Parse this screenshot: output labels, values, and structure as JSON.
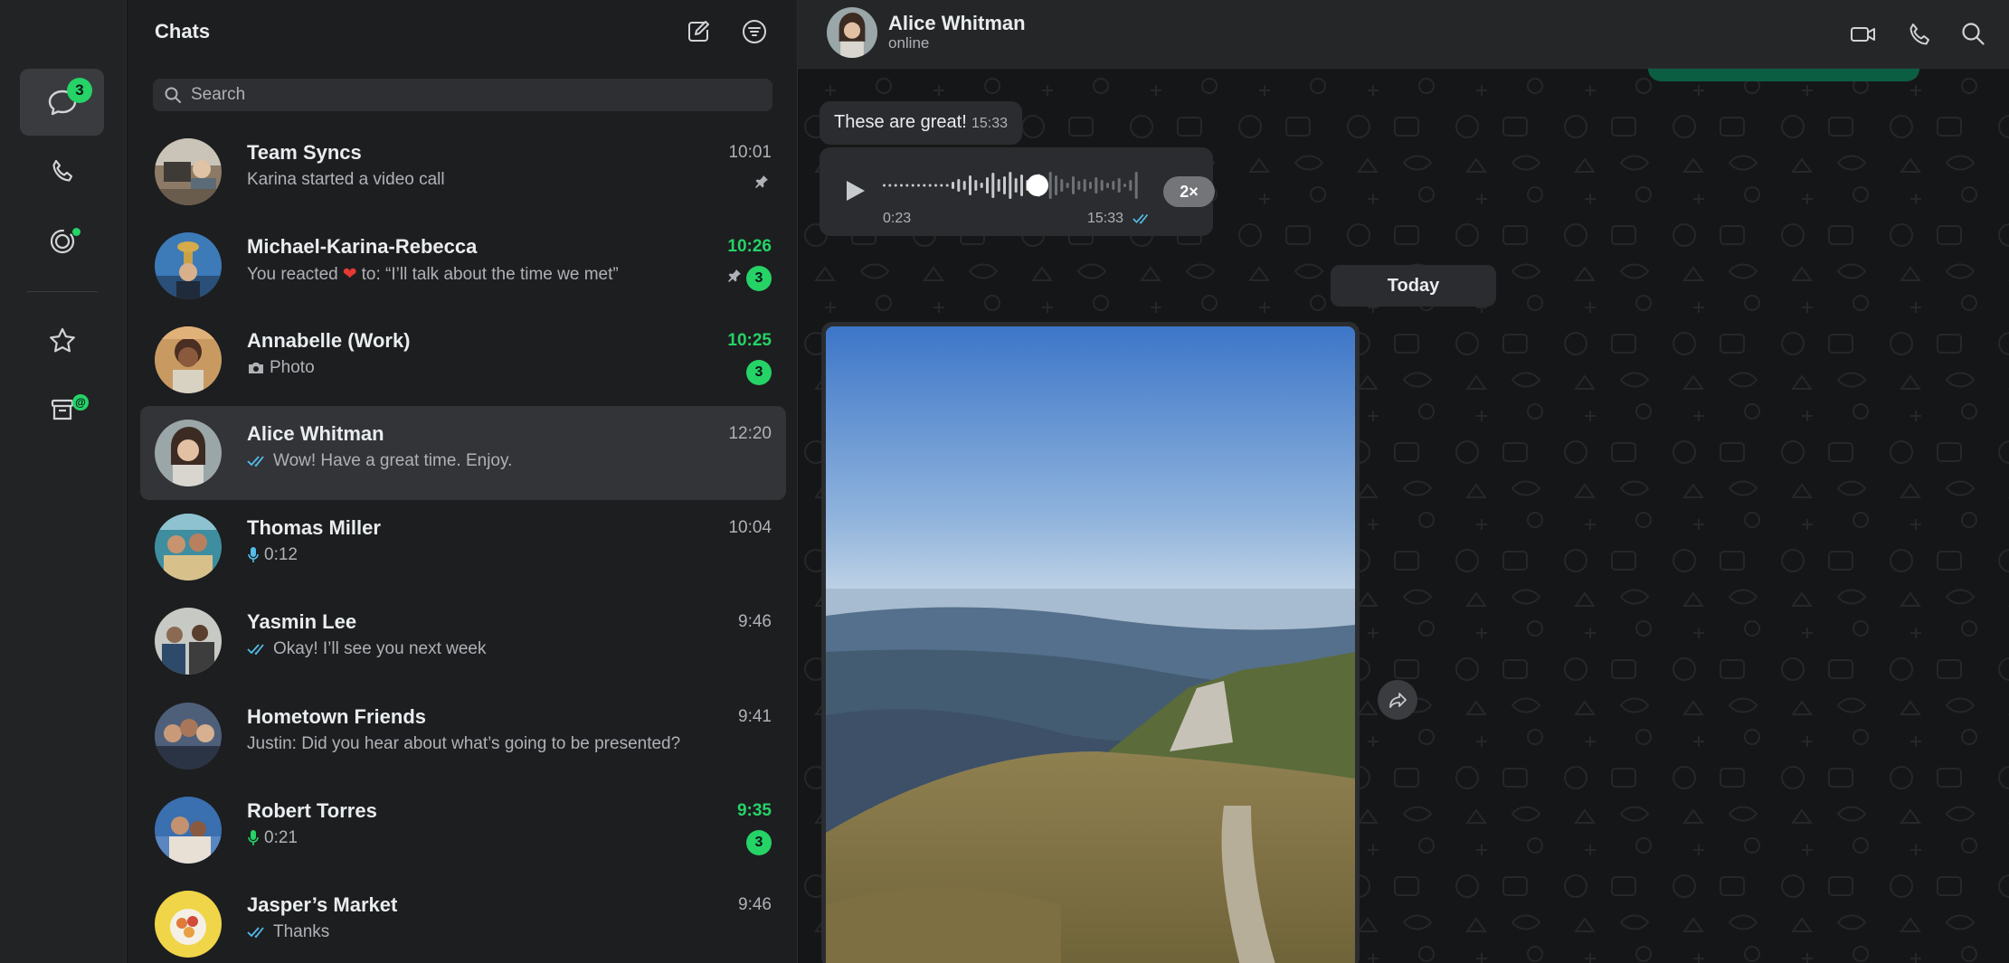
{
  "rail": {
    "chats_badge": "3",
    "items": [
      "chats-icon",
      "calls-icon",
      "status-icon",
      "starred-icon",
      "archive-icon"
    ],
    "archive_badge": "@"
  },
  "chat_list": {
    "title": "Chats",
    "search_placeholder": "Search",
    "chats": [
      {
        "name": "Team Syncs",
        "time": "10:01",
        "preview": "Karina started a video call",
        "pinned": true
      },
      {
        "name": "Michael-Karina-Rebecca",
        "time": "10:26",
        "preview_prefix": "You reacted",
        "preview_emoji": "❤",
        "preview_suffix": "to: “I’ll talk about the time we met”",
        "pinned": true,
        "unread": "3"
      },
      {
        "name": "Annabelle (Work)",
        "time": "10:25",
        "preview": "Photo",
        "unread": "3"
      },
      {
        "name": "Alice Whitman",
        "time": "12:20",
        "preview": "Wow! Have a great time. Enjoy."
      },
      {
        "name": "Thomas Miller",
        "time": "10:04",
        "preview": "0:12"
      },
      {
        "name": "Yasmin Lee",
        "time": "9:46",
        "preview": "Okay! I’ll see you next week"
      },
      {
        "name": "Hometown Friends",
        "time": "9:41",
        "preview": "Justin: Did you hear about what’s going to be presented?"
      },
      {
        "name": "Robert Torres",
        "time": "9:35",
        "preview": "0:21",
        "unread": "3"
      },
      {
        "name": "Jasper’s Market",
        "time": "9:46",
        "preview": "Thanks"
      }
    ]
  },
  "conversation": {
    "name": "Alice Whitman",
    "status": "online",
    "messages": {
      "text1": {
        "text": "These are great!",
        "time": "15:33"
      },
      "voice": {
        "elapsed": "0:23",
        "time": "15:33",
        "speed": "2×",
        "progress": 0.6
      },
      "day_separator": "Today"
    }
  },
  "colors": {
    "accent": "#25d366",
    "read_tick": "#53bdeb",
    "panel": "#1d1e20",
    "bubble": "#2b2c2f"
  }
}
